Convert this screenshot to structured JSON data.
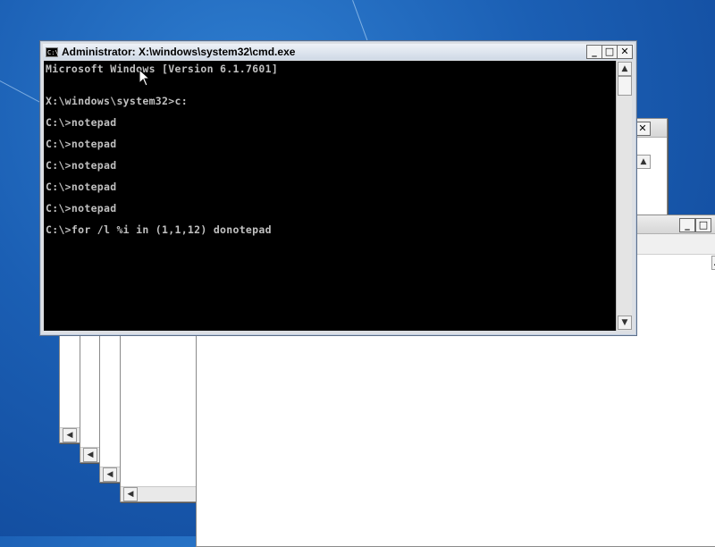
{
  "desktop": {
    "background_color": "#1b5fb4"
  },
  "notepad_windows": {
    "count": 5,
    "title_buttons": {
      "minimize": "_",
      "maximize": "□",
      "close": "✕"
    },
    "scroll_left_glyph": "◀",
    "scroll_up_glyph": "▲"
  },
  "cmd": {
    "title": "Administrator: X:\\windows\\system32\\cmd.exe",
    "icon_label": "C:\\",
    "buttons": {
      "minimize": "_",
      "maximize": "□",
      "close": "✕"
    },
    "scroll_up_glyph": "▲",
    "scroll_down_glyph": "▼",
    "lines": [
      "Microsoft Windows [Version 6.1.7601]",
      "",
      "X:\\windows\\system32>c:",
      "",
      "C:\\>notepad",
      "",
      "C:\\>notepad",
      "",
      "C:\\>notepad",
      "",
      "C:\\>notepad",
      "",
      "C:\\>notepad",
      "",
      "C:\\>for /l %i in (1,1,12) donotepad"
    ],
    "text_color": "#c0c0c0",
    "background_color": "#000000"
  }
}
